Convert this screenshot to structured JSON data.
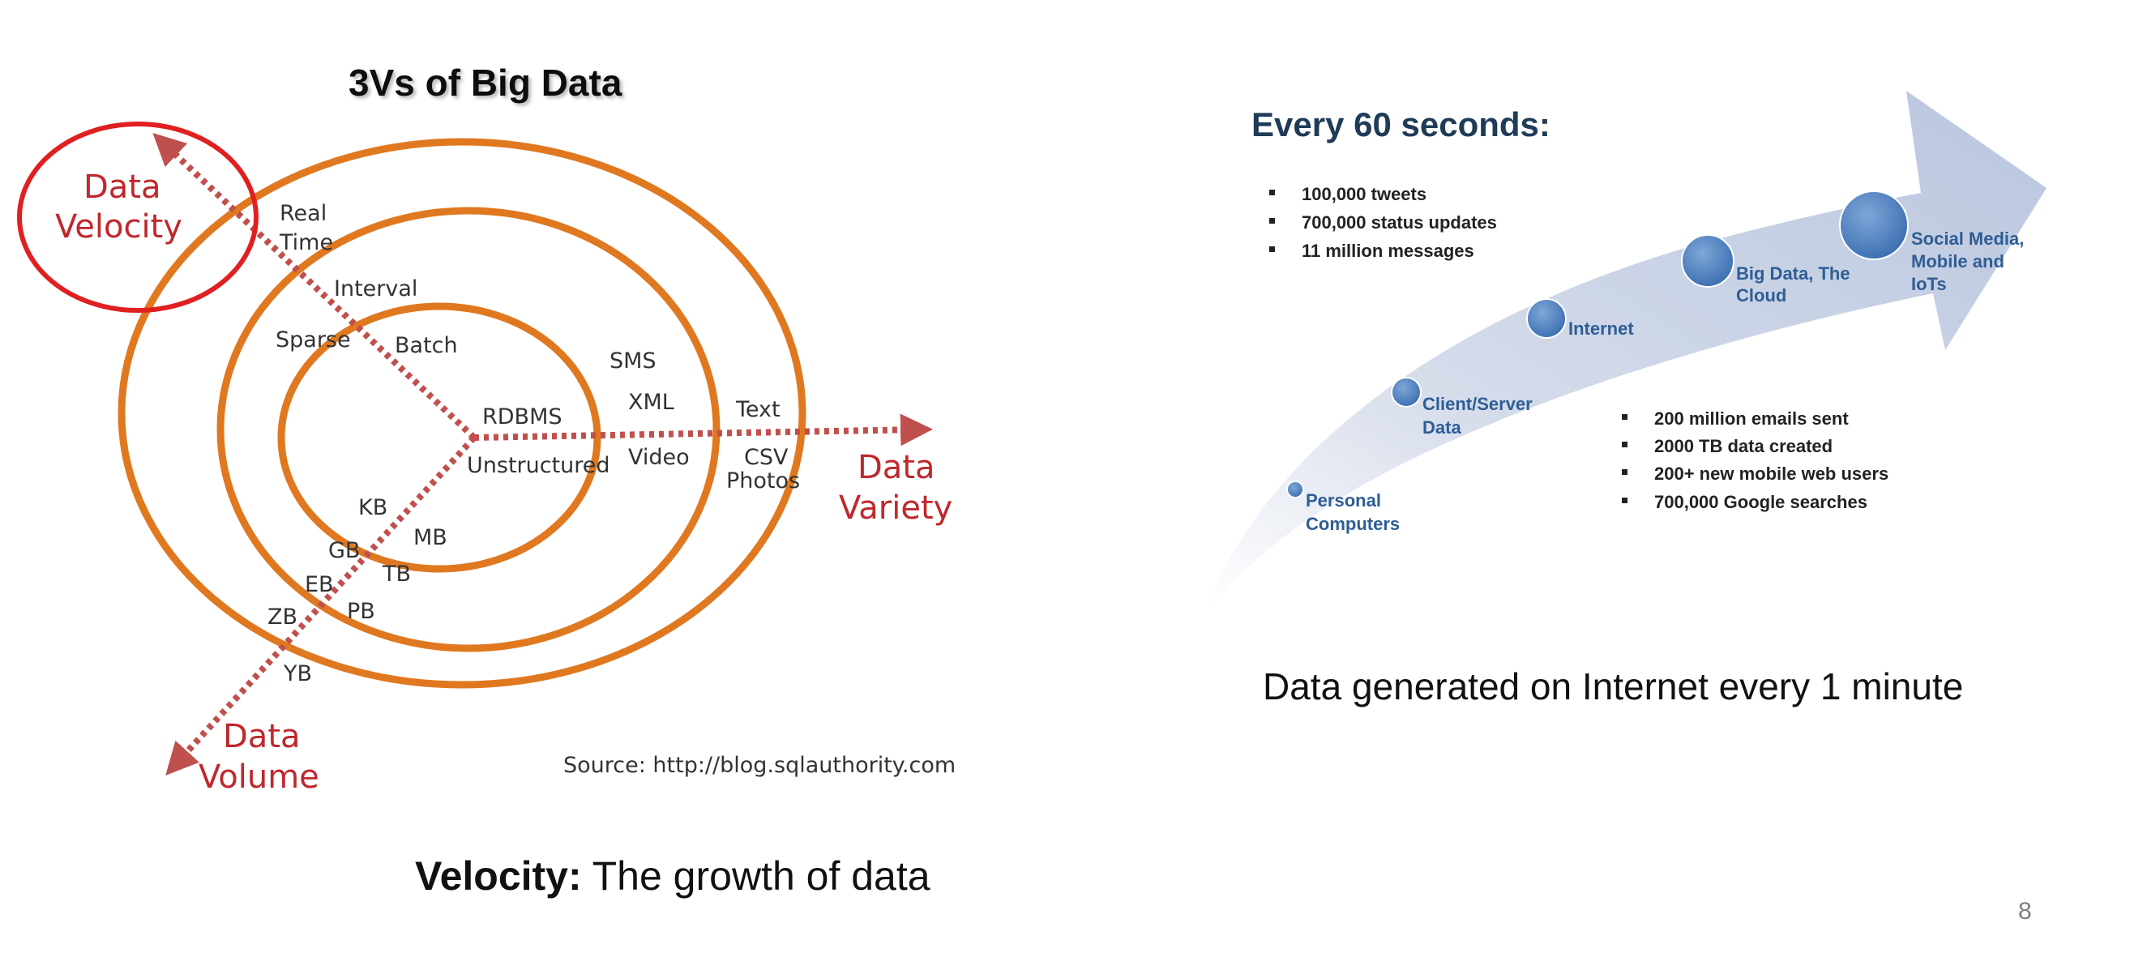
{
  "left_diagram": {
    "title": "3Vs of Big Data",
    "axes": {
      "velocity": [
        "Data",
        "Velocity"
      ],
      "variety": [
        "Data",
        "Variety"
      ],
      "volume": [
        "Data",
        "Volume"
      ]
    },
    "velocity_labels": [
      "Real",
      "Time",
      "Interval",
      "Sparse",
      "Batch"
    ],
    "variety_labels": [
      "RDBMS",
      "Unstructured",
      "SMS",
      "XML",
      "Video",
      "Text",
      "CSV",
      "Photos"
    ],
    "volume_labels": [
      "KB",
      "MB",
      "GB",
      "TB",
      "EB",
      "PB",
      "ZB",
      "YB"
    ],
    "source": "Source: http://blog.sqlauthority.com",
    "colors": {
      "rings": "#e07820",
      "axes": "#c0504d",
      "highlight": "#e02020"
    }
  },
  "caption_left": {
    "bold": "Velocity:",
    "text": " The growth of data"
  },
  "right_diagram": {
    "title": "Every 60 seconds:",
    "bullets_top": [
      "100,000 tweets",
      "700,000 status updates",
      "11 million messages"
    ],
    "bullets_bottom": [
      "200 million emails sent",
      "2000 TB data created",
      "200+ new mobile web users",
      "700,000 Google searches"
    ],
    "milestones": [
      [
        "Personal",
        "Computers"
      ],
      [
        "Client/Server",
        "Data"
      ],
      [
        "Internet"
      ],
      [
        "Big Data, The",
        "Cloud"
      ],
      [
        "Social Media,",
        "Mobile and",
        "IoTs"
      ]
    ],
    "colors": {
      "arrow": "#c9d3e6",
      "dots": "#4a7fc0"
    }
  },
  "caption_right": "Data generated on Internet every 1 minute",
  "page_number": "8"
}
